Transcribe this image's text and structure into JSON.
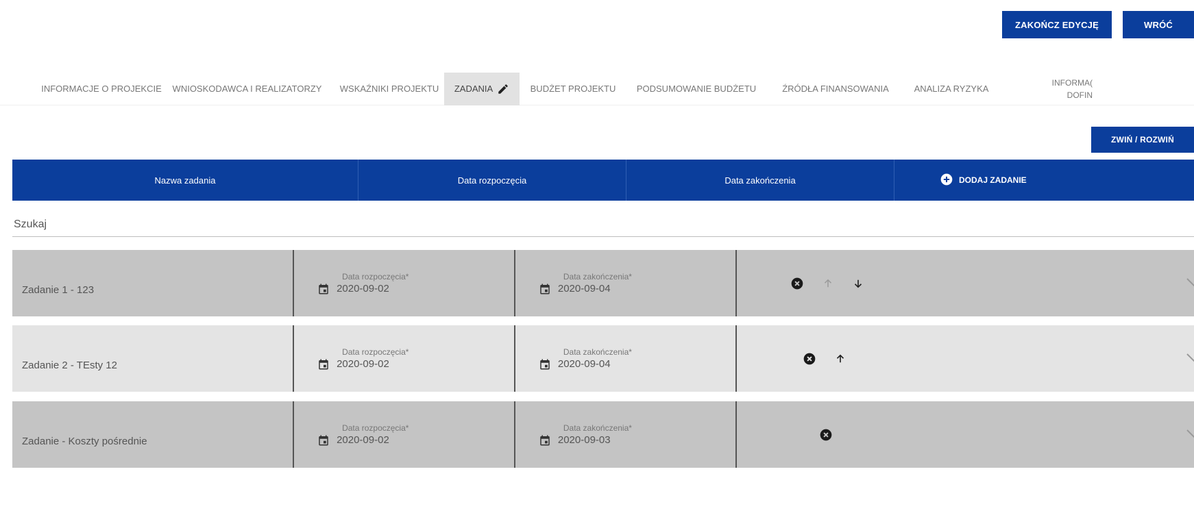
{
  "top": {
    "finish_label": "ZAKOŃCZ EDYCJĘ",
    "back_label": "WRÓĆ"
  },
  "tabs": [
    {
      "label": "INFORMACJE O PROJEKCIE"
    },
    {
      "label": "WNIOSKODAWCA I REALIZATORZY"
    },
    {
      "label": "WSKAŹNIKI PROJEKTU"
    },
    {
      "label": "ZADANIA",
      "active": true
    },
    {
      "label": "BUDŻET PROJEKTU"
    },
    {
      "label": "PODSUMOWANIE BUDŻETU"
    },
    {
      "label": "ŹRÓDŁA FINANSOWANIA"
    },
    {
      "label": "ANALIZA RYZYKA"
    },
    {
      "label_line1": "INFORMA(",
      "label_line2": "DOFIN"
    }
  ],
  "toggle_label": "ZWIŃ / ROZWIŃ",
  "table": {
    "headers": {
      "name": "Nazwa zadania",
      "start": "Data rozpoczęcia",
      "end": "Data zakończenia",
      "add": "DODAJ ZADANIE"
    },
    "search_placeholder": "Szukaj",
    "rows": [
      {
        "name": "Zadanie 1 - 123",
        "start_label": "Data rozpoczęcia*",
        "start": "2020-09-02",
        "end_label": "Data zakończenia*",
        "end": "2020-09-04",
        "up_enabled": false,
        "down": true
      },
      {
        "name": "Zadanie 2 - TEsty 12",
        "start_label": "Data rozpoczęcia*",
        "start": "2020-09-02",
        "end_label": "Data zakończenia*",
        "end": "2020-09-04",
        "up_enabled": true,
        "down": false
      },
      {
        "name": "Zadanie - Koszty pośrednie",
        "start_label": "Data rozpoczęcia*",
        "start": "2020-09-02",
        "end_label": "Data zakończenia*",
        "end": "2020-09-03",
        "up_enabled": null,
        "down": false
      }
    ]
  },
  "colors": {
    "primary": "#0b3e9c",
    "row_dark": "#c4c4c4",
    "row_light": "#e4e4e4"
  }
}
